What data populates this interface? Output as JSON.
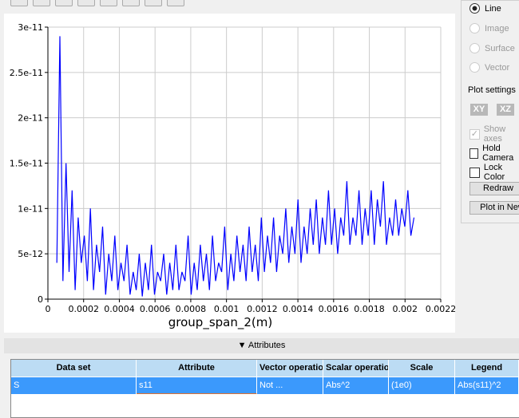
{
  "toolbar": {
    "icons": [
      "zoom-box-icon",
      "pan-icon",
      "zoom-in-icon",
      "zoom-out-icon",
      "view-icon",
      "color-icon",
      "grid-icon",
      "edit-icon"
    ]
  },
  "side": {
    "radios": [
      {
        "label": "Line",
        "checked": true
      },
      {
        "label": "Image",
        "checked": false
      },
      {
        "label": "Surface",
        "checked": false
      },
      {
        "label": "Vector",
        "checked": false
      }
    ],
    "plot_settings": "Plot settings",
    "xy": "XY",
    "xz": "XZ",
    "show_axes": "Show axes",
    "hold_camera": "Hold Camera",
    "lock_color": "Lock Color",
    "redraw": "Redraw",
    "plot_in": "Plot in New"
  },
  "attributes": {
    "toggle": "▼ Attributes",
    "headers": [
      "Data set",
      "Attribute",
      "Vector operation",
      "Scalar operation",
      "Scale",
      "Legend"
    ],
    "row": [
      "S",
      "s11",
      "Not ...",
      "Abs^2",
      "(1e0)",
      "Abs(s11)^2"
    ]
  },
  "chart_data": {
    "type": "line",
    "xlabel": "group_span_2(m)",
    "ylabel": "",
    "xlim": [
      0,
      0.0022
    ],
    "ylim": [
      0,
      3e-11
    ],
    "xticks": [
      "0",
      "0.0002",
      "0.0004",
      "0.0006",
      "0.0008",
      "0.001",
      "0.0012",
      "0.0014",
      "0.0016",
      "0.0018",
      "0.002",
      "0.0022"
    ],
    "yticks": [
      "0",
      "5e-12",
      "1e-11",
      "1.5e-11",
      "2e-11",
      "2.5e-11",
      "3e-11"
    ],
    "color": "#0000ff",
    "y_unit": 1e-12,
    "x_start": 5e-05,
    "x_end": 0.00205,
    "values": [
      4,
      29,
      2,
      15,
      3,
      12,
      1,
      9,
      4,
      7,
      2,
      10,
      1,
      6,
      3,
      8,
      0.5,
      5,
      2,
      7,
      1,
      4,
      2,
      6,
      0.5,
      3,
      1,
      5,
      0.3,
      4,
      1,
      6,
      0.5,
      3,
      2,
      5,
      0.5,
      4,
      1,
      6,
      1,
      3,
      2,
      7,
      0.5,
      4,
      1,
      6,
      2,
      5,
      1,
      7,
      2,
      4,
      3,
      8,
      1,
      5,
      2,
      7,
      3,
      6,
      2,
      8,
      3,
      6,
      2,
      9,
      3,
      7,
      4,
      9,
      3,
      7,
      5,
      10,
      4,
      8,
      5,
      11,
      4,
      8,
      5,
      10,
      6,
      11,
      5,
      9,
      6,
      12,
      6,
      10,
      5,
      9,
      7,
      13,
      6,
      9,
      7,
      12,
      6,
      10,
      7,
      12,
      6,
      11,
      8,
      13,
      6,
      9,
      7,
      11,
      7,
      10,
      8,
      12,
      7,
      9
    ]
  }
}
